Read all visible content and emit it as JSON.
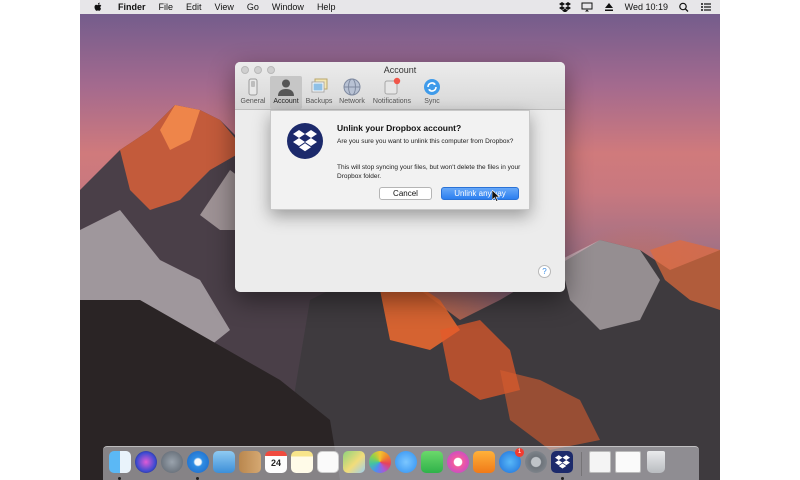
{
  "menubar": {
    "app": "Finder",
    "items": [
      "File",
      "Edit",
      "View",
      "Go",
      "Window",
      "Help"
    ],
    "clock": "Wed 10:19",
    "status_icons": [
      "dropbox-icon",
      "display-mirror-icon",
      "eject-icon",
      "search-icon",
      "notification-center-icon"
    ]
  },
  "prefs_window": {
    "title": "Account",
    "tabs": [
      {
        "label": "General",
        "icon": "general-switch-icon",
        "selected": false
      },
      {
        "label": "Account",
        "icon": "account-person-icon",
        "selected": true
      },
      {
        "label": "Backups",
        "icon": "backups-photos-icon",
        "selected": false
      },
      {
        "label": "Network",
        "icon": "network-globe-icon",
        "selected": false
      },
      {
        "label": "Notifications",
        "icon": "notifications-icon",
        "selected": false
      },
      {
        "label": "Sync",
        "icon": "sync-icon",
        "selected": false
      }
    ],
    "help": "?"
  },
  "dialog": {
    "title": "Unlink your Dropbox account?",
    "message": "Are you sure you want to unlink this computer from Dropbox?",
    "detail": "This will stop syncing your files, but won't delete the files in your Dropbox folder.",
    "cancel_label": "Cancel",
    "confirm_label": "Unlink anyway"
  },
  "dock": {
    "calendar_day": "24",
    "app_store_badge": "1",
    "apps": [
      "finder-icon",
      "siri-icon",
      "launchpad-icon",
      "safari-icon",
      "mail-icon",
      "contacts-icon",
      "calendar-icon",
      "notes-icon",
      "reminders-icon",
      "maps-icon",
      "photos-icon",
      "messages-icon",
      "facetime-icon",
      "itunes-icon",
      "ibooks-icon",
      "app-store-icon",
      "system-preferences-icon",
      "dropbox-icon",
      "document-icon",
      "downloads-icon",
      "trash-icon"
    ]
  },
  "colors": {
    "accent": "#2c7ff0",
    "dropbox_navy": "#1c2a6b"
  }
}
